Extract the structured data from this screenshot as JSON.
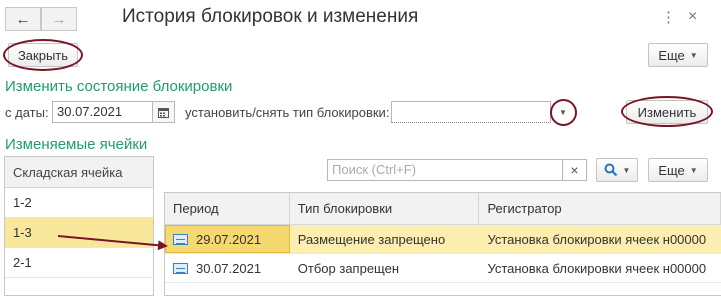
{
  "window": {
    "title": "История блокировок и изменения",
    "back_icon": "←",
    "forward_icon": "→",
    "more_icon": "⋮",
    "close_icon": "×"
  },
  "toolbar": {
    "close_label": "Закрыть",
    "more_label": "Еще"
  },
  "change_state": {
    "section_title": "Изменить состояние блокировки",
    "date_label": "с даты:",
    "date_value": "30.07.2021",
    "calendar_icon": "calendar-icon",
    "type_label": "установить/снять тип блокировки:",
    "type_value": "",
    "change_button": "Изменить"
  },
  "cells": {
    "section_title": "Изменяемые ячейки",
    "search_placeholder": "Поиск (Ctrl+F)",
    "clear_icon": "×",
    "more_label": "Еще",
    "list_header": "Складская ячейка",
    "list_items": [
      "1-2",
      "1-3",
      "2-1"
    ],
    "selected_index": 1
  },
  "grid": {
    "columns": [
      "Период",
      "Тип блокировки",
      "Регистратор"
    ],
    "rows": [
      {
        "period": "29.07.2021",
        "type": "Размещение запрещено",
        "registrar": "Установка блокировки ячеек н00000"
      },
      {
        "period": "30.07.2021",
        "type": "Отбор запрещен",
        "registrar": "Установка блокировки ячеек н00000"
      }
    ],
    "selected_index": 0
  },
  "colors": {
    "accent_green": "#229b6e",
    "annotation_red": "#7b1526",
    "selection_yellow": "#f9e79c"
  }
}
